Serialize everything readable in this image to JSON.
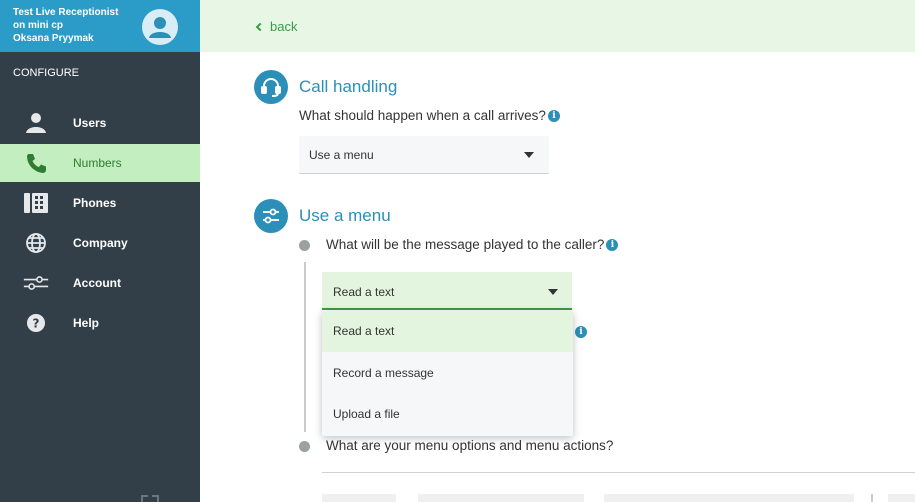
{
  "sidebar": {
    "account_line1": "Test Live Receptionist",
    "account_line2": "on mini cp",
    "account_line3": "Oksana Pryymak",
    "section_label": "CONFIGURE",
    "items": [
      {
        "label": "Users",
        "icon": "user-icon",
        "active": false
      },
      {
        "label": "Numbers",
        "icon": "phone-icon",
        "active": true
      },
      {
        "label": "Phones",
        "icon": "desk-phone-icon",
        "active": false
      },
      {
        "label": "Company",
        "icon": "globe-icon",
        "active": false
      },
      {
        "label": "Account",
        "icon": "sliders-icon",
        "active": false
      },
      {
        "label": "Help",
        "icon": "help-icon",
        "active": false
      }
    ]
  },
  "topbar": {
    "back_label": "back"
  },
  "call_handling": {
    "title": "Call handling",
    "question": "What should happen when a call arrives?",
    "select_value": "Use a menu"
  },
  "use_menu": {
    "title": "Use a menu",
    "q1": "What will be the message played to the caller?",
    "select_value": "Read a text",
    "dropdown_options": [
      "Read a text",
      "Record a message",
      "Upload a file"
    ],
    "q2": "What are your menu options and menu actions?"
  },
  "colors": {
    "sidebar_bg": "#333f48",
    "accent_blue": "#2b8fb8",
    "accent_green": "#3a9b45",
    "active_bg": "#c3eec0"
  }
}
